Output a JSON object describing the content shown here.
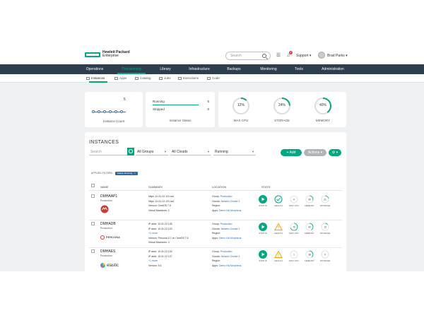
{
  "brand": {
    "name": "Hewlett Packard",
    "sub": "Enterprise",
    "color": "#01a982"
  },
  "topbar": {
    "search_placeholder": "Search",
    "notification_count": "3",
    "support_label": "Support ▾",
    "user_label": "Brad Parks ▾"
  },
  "nav": {
    "items": [
      "Operations",
      "Provisioning",
      "Library",
      "Infrastructure",
      "Backups",
      "Monitoring",
      "Tools",
      "Administration"
    ],
    "active": "Provisioning"
  },
  "subnav": {
    "items": [
      "Instances",
      "Apps",
      "Catalog",
      "Jobs",
      "Executions",
      "Code"
    ],
    "active": "Instances"
  },
  "summary": {
    "instance_count_value": "5",
    "instance_count_caption": "Instance Count",
    "status_rows": [
      {
        "label": "Running",
        "value": "5"
      },
      {
        "label": "Stopped",
        "value": "0"
      }
    ],
    "status_caption": "Instance Status",
    "gauges": [
      {
        "pct_text": "12%",
        "label": "MAX CPU",
        "value": 0.12
      },
      {
        "pct_text": "24%",
        "label": "STORAGE",
        "value": 0.24
      },
      {
        "pct_text": "40%",
        "label": "MEMORY",
        "value": 0.4
      }
    ]
  },
  "instances": {
    "title": "INSTANCES",
    "search_placeholder": "Search",
    "filters": {
      "groups": "All Groups",
      "clouds": "All Clouds",
      "status": "Running"
    },
    "add_label": "+ Add",
    "actions_label": "Actions ▾",
    "more_label": "⚙ ▾",
    "applied_filters_label": "APPLIED FILTERS:",
    "applied_filter_tag": "Status: Running",
    "columns": [
      "NAME",
      "SUMMARY",
      "LOCATION",
      "STATS"
    ],
    "stat_labels": [
      "STATUS",
      "HEALTH",
      "MAX CPU",
      "MEMORY",
      "STORAGE"
    ],
    "rows": [
      {
        "name": "DMHAAP1",
        "group": "Production",
        "summary": [
          "https: 10.31.22.121:ss1",
          "https: 10.31.22.121:ss2",
          "Version: CentOS 7.5",
          "Virtual Machines: 2"
        ],
        "location": {
          "group_label": "Group:",
          "group": "Production",
          "cloud_label": "Clouds:",
          "cloud": "Nutanix Cluster 1",
          "region_label": "Region:",
          "apps_label": "Apps:",
          "apps": "Demo HA Morpheus"
        },
        "logo": "openshift",
        "health": "ok",
        "stats": [
          "0",
          "30",
          "21"
        ]
      },
      {
        "name": "DMHADB",
        "group": "Production",
        "summary": [
          "IP addr: 10.31.22.125",
          "IP addr: 10.31.22.123",
          "+1 more",
          "Version: Percona 5.7 on CentOS 7.5",
          "Virtual Machines: 3"
        ],
        "location": {
          "group_label": "Group:",
          "group": "Production",
          "cloud_label": "Clouds:",
          "cloud": "Nutanix Cluster 1",
          "region_label": "Region:",
          "apps_label": "Apps:",
          "apps": "Demo HA Morpheus"
        },
        "logo_text": "PERCONA",
        "health": "warn",
        "stats": [
          "70",
          "42",
          "13"
        ]
      },
      {
        "name": "DMHAES",
        "group": "Production",
        "summary": [
          "IP addr: 10.31.22.124",
          "IP addr: 10.31.22.127",
          "+1 more",
          "Version: 5.6"
        ],
        "location": {
          "group_label": "Group:",
          "group": "Production",
          "cloud_label": "Clouds:",
          "cloud": "Nutanix Cluster 1",
          "region_label": "Region:",
          "apps_label": "Apps:",
          "apps": "Demo HA Morpheus"
        },
        "logo_text": "elastic",
        "health": "warn",
        "stats": [
          "1",
          "38",
          "0"
        ]
      }
    ]
  }
}
